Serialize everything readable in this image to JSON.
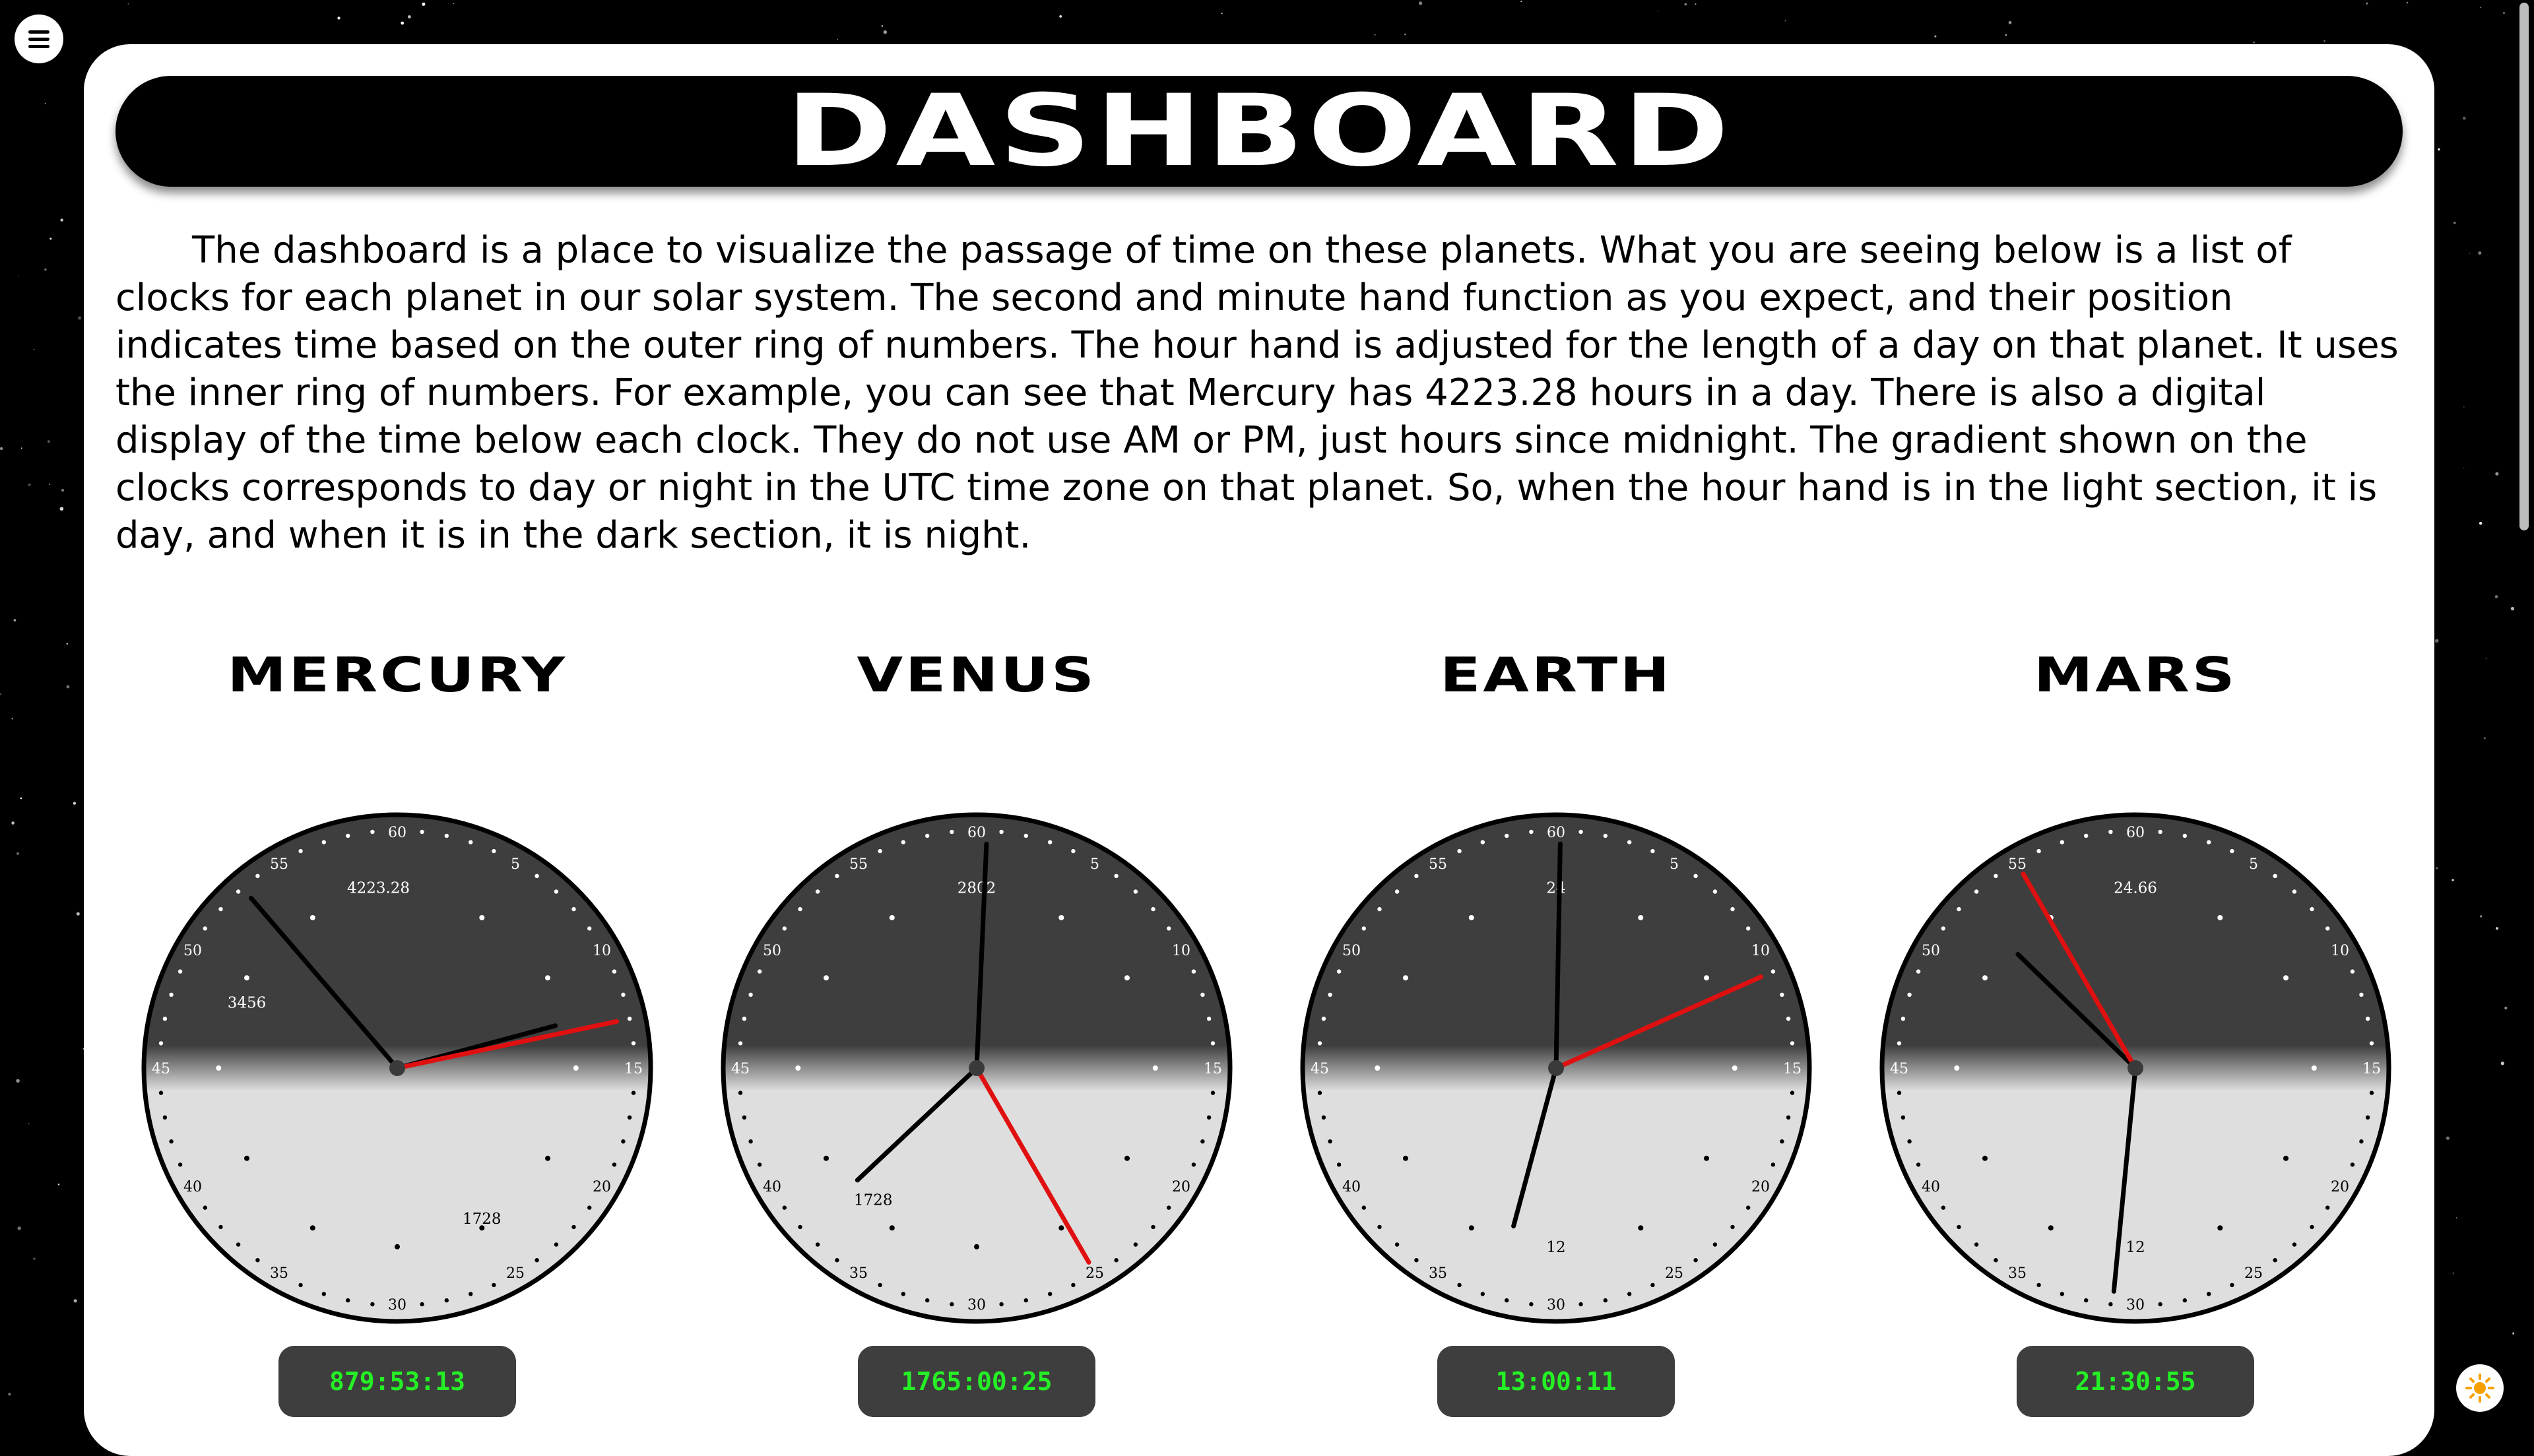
{
  "header": {
    "title": "DASHBOARD"
  },
  "intro": {
    "text": "The dashboard is a place to visualize the passage of time on these planets. What you are seeing below is a list of clocks for each planet in our solar system. The second and minute hand function as you expect, and their position indicates time based on the outer ring of numbers. The hour hand is adjusted for the length of a day on that planet. It uses the inner ring of numbers. For example, you can see that Mercury has 4223.28 hours in a day. There is also a digital display of the time below each clock. They do not use AM or PM, just hours since midnight. The gradient shown on the clocks corresponds to day or night in the UTC time zone on that planet. So, when the hour hand is in the light section, it is day, and when it is in the dark section, it is night."
  },
  "controls": {
    "menu_icon": "hamburger-menu-icon",
    "theme_icon": "sun-icon"
  },
  "colors": {
    "night": "#3e3e3e",
    "day": "#dedede",
    "second_hand": "#e01010",
    "hour_minute_hand": "#000000",
    "digital_text": "#25f025",
    "digital_bg": "#3e3e3e"
  },
  "clocks": [
    {
      "name": "MERCURY",
      "digital_time": "879:53:13",
      "outer_labels": [
        "60",
        "5",
        "10",
        "15",
        "20",
        "25",
        "30",
        "35",
        "40",
        "45",
        "50",
        "55"
      ],
      "inner_labels": [
        "4223.28",
        "1728",
        "3456"
      ],
      "hours_per_day": 4223.28,
      "hour": 879.887,
      "minute": 53.22,
      "second": 13
    },
    {
      "name": "VENUS",
      "digital_time": "1765:00:25",
      "outer_labels": [
        "60",
        "5",
        "10",
        "15",
        "20",
        "25",
        "30",
        "35",
        "40",
        "45",
        "50",
        "55"
      ],
      "inner_labels": [
        "2802",
        "1728"
      ],
      "hours_per_day": 2802,
      "hour": 1765.007,
      "minute": 0.42,
      "second": 25
    },
    {
      "name": "EARTH",
      "digital_time": "13:00:11",
      "outer_labels": [
        "60",
        "5",
        "10",
        "15",
        "20",
        "25",
        "30",
        "35",
        "40",
        "45",
        "50",
        "55"
      ],
      "inner_labels": [
        "24",
        "12"
      ],
      "hours_per_day": 24,
      "hour": 13.003,
      "minute": 0.18,
      "second": 11
    },
    {
      "name": "MARS",
      "digital_time": "21:30:55",
      "outer_labels": [
        "60",
        "5",
        "10",
        "15",
        "20",
        "25",
        "30",
        "35",
        "40",
        "45",
        "50",
        "55"
      ],
      "inner_labels": [
        "24.66",
        "12"
      ],
      "hours_per_day": 24.66,
      "hour": 21.515,
      "minute": 30.92,
      "second": 55
    }
  ]
}
